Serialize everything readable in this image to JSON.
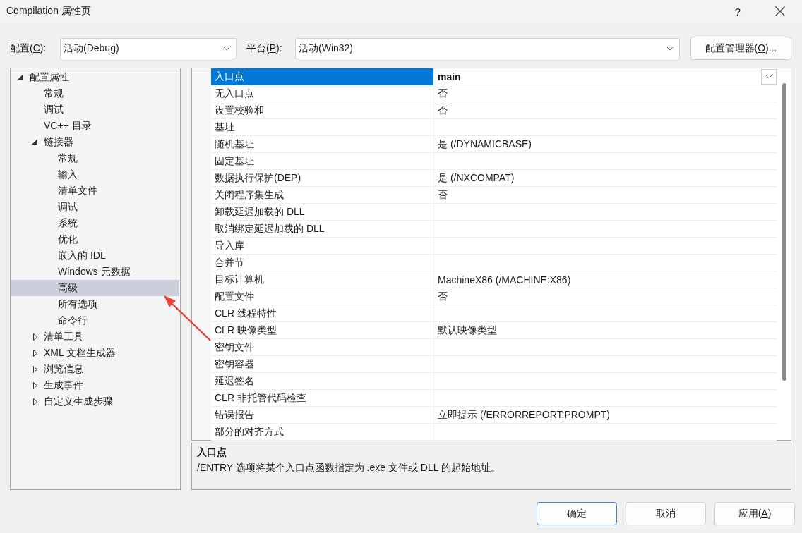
{
  "window": {
    "title": "Compilation 属性页",
    "help": "?"
  },
  "config_bar": {
    "configuration": {
      "label": "配置(",
      "access_key": "C",
      "label_end": "):",
      "value": "活动(Debug)"
    },
    "platform": {
      "label": "平台(",
      "access_key": "P",
      "label_end": "):",
      "value": "活动(Win32)"
    },
    "manager_button": {
      "label": "配置管理器(",
      "access_key": "O",
      "label_end": ")..."
    }
  },
  "tree": [
    {
      "label": "配置属性",
      "expanded": true,
      "selected": false,
      "children": [
        {
          "label": "常规",
          "selected": false
        },
        {
          "label": "调试",
          "selected": false
        },
        {
          "label": "VC++ 目录",
          "selected": false
        },
        {
          "label": "链接器",
          "expanded": true,
          "selected": false,
          "children": [
            {
              "label": "常规",
              "selected": false
            },
            {
              "label": "输入",
              "selected": false
            },
            {
              "label": "清单文件",
              "selected": false
            },
            {
              "label": "调试",
              "selected": false
            },
            {
              "label": "系统",
              "selected": false
            },
            {
              "label": "优化",
              "selected": false
            },
            {
              "label": "嵌入的 IDL",
              "selected": false
            },
            {
              "label": "Windows 元数据",
              "selected": false
            },
            {
              "label": "高级",
              "selected": true
            },
            {
              "label": "所有选项",
              "selected": false
            },
            {
              "label": "命令行",
              "selected": false
            }
          ]
        },
        {
          "label": "清单工具",
          "expanded": false,
          "selected": false
        },
        {
          "label": "XML 文档生成器",
          "expanded": false,
          "selected": false
        },
        {
          "label": "浏览信息",
          "expanded": false,
          "selected": false
        },
        {
          "label": "生成事件",
          "expanded": false,
          "selected": false
        },
        {
          "label": "自定义生成步骤",
          "expanded": false,
          "selected": false
        }
      ]
    }
  ],
  "properties": [
    {
      "name": "入口点",
      "value": "main",
      "selected": true,
      "modified": true
    },
    {
      "name": "无入口点",
      "value": "否",
      "selected": false,
      "modified": false
    },
    {
      "name": "设置校验和",
      "value": "否",
      "selected": false,
      "modified": false
    },
    {
      "name": "基址",
      "selected": false
    },
    {
      "name": "随机基址",
      "value": "是 (/DYNAMICBASE)",
      "selected": false,
      "modified": false
    },
    {
      "name": "固定基址",
      "selected": false
    },
    {
      "name": "数据执行保护(DEP)",
      "value": "是 (/NXCOMPAT)",
      "selected": false,
      "modified": false
    },
    {
      "name": "关闭程序集生成",
      "value": "否",
      "selected": false,
      "modified": false
    },
    {
      "name": "卸载延迟加载的 DLL",
      "selected": false
    },
    {
      "name": "取消绑定延迟加载的 DLL",
      "selected": false
    },
    {
      "name": "导入库",
      "selected": false
    },
    {
      "name": "合并节",
      "selected": false
    },
    {
      "name": "目标计算机",
      "value": "MachineX86 (/MACHINE:X86)",
      "selected": false,
      "modified": false
    },
    {
      "name": "配置文件",
      "value": "否",
      "selected": false,
      "modified": false
    },
    {
      "name": "CLR 线程特性",
      "selected": false
    },
    {
      "name": "CLR 映像类型",
      "value": "默认映像类型",
      "selected": false,
      "modified": false
    },
    {
      "name": "密钥文件",
      "selected": false
    },
    {
      "name": "密钥容器",
      "selected": false
    },
    {
      "name": "延迟签名",
      "selected": false
    },
    {
      "name": "CLR 非托管代码检查",
      "selected": false
    },
    {
      "name": "错误报告",
      "value": "立即提示 (/ERRORREPORT:PROMPT)",
      "selected": false,
      "modified": false
    },
    {
      "name": "部分的对齐方式",
      "selected": false
    }
  ],
  "description": {
    "title": "入口点",
    "text": "/ENTRY 选项将某个入口点函数指定为 .exe 文件或 DLL 的起始地址。"
  },
  "buttons": [
    {
      "label": "确定",
      "default": true
    },
    {
      "label": "取消",
      "default": false
    },
    {
      "label": "应用(",
      "access_key": "A",
      "label_end": ")",
      "default": false
    }
  ],
  "annotations": [
    {
      "kind": "arrow"
    }
  ]
}
